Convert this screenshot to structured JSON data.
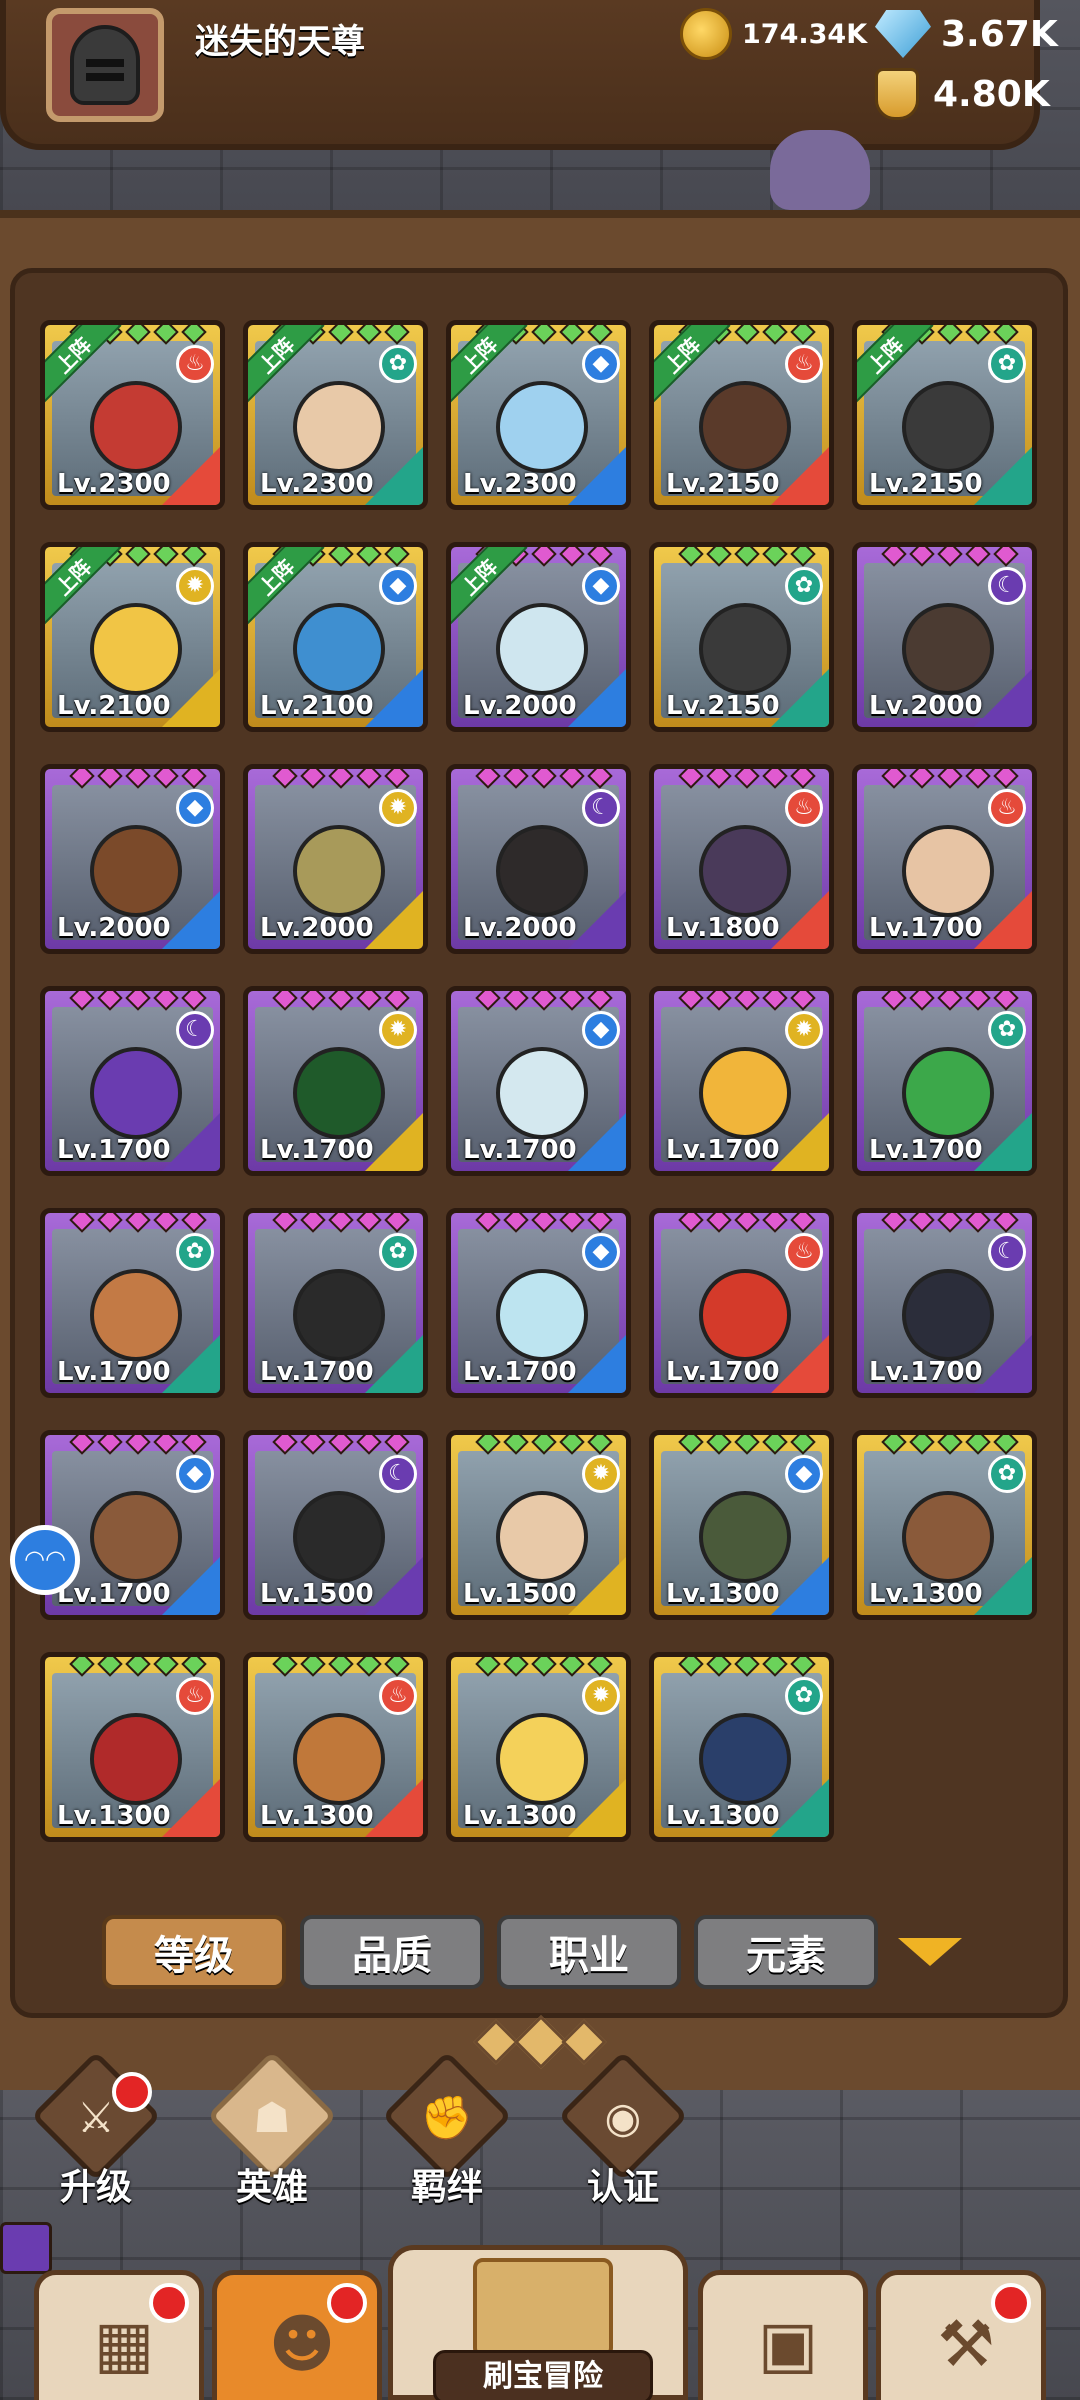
{
  "header": {
    "player_name": "迷失的天尊",
    "gold": "174.34K",
    "gems": "3.67K",
    "potions": "4.80K"
  },
  "on_team_label": "上阵",
  "heroes": [
    {
      "lv": "Lv.2300",
      "elem": "fire",
      "rarity": "gold",
      "on_team": true,
      "face": "#c43b33"
    },
    {
      "lv": "Lv.2300",
      "elem": "wind",
      "rarity": "gold",
      "on_team": true,
      "face": "#e8c9a8"
    },
    {
      "lv": "Lv.2300",
      "elem": "water",
      "rarity": "gold",
      "on_team": true,
      "face": "#9fd1ef"
    },
    {
      "lv": "Lv.2150",
      "elem": "fire",
      "rarity": "gold",
      "on_team": true,
      "face": "#5a3a2a"
    },
    {
      "lv": "Lv.2150",
      "elem": "wind",
      "rarity": "gold",
      "on_team": true,
      "face": "#3a3a3a"
    },
    {
      "lv": "Lv.2100",
      "elem": "light",
      "rarity": "gold",
      "on_team": true,
      "face": "#f1c545"
    },
    {
      "lv": "Lv.2100",
      "elem": "water",
      "rarity": "gold",
      "on_team": true,
      "face": "#3f8fd0"
    },
    {
      "lv": "Lv.2000",
      "elem": "water",
      "rarity": "purple",
      "on_team": true,
      "face": "#cfe6ef"
    },
    {
      "lv": "Lv.2150",
      "elem": "wind",
      "rarity": "gold",
      "on_team": false,
      "face": "#3a3a3a"
    },
    {
      "lv": "Lv.2000",
      "elem": "dark",
      "rarity": "purple",
      "on_team": false,
      "face": "#4b3b32"
    },
    {
      "lv": "Lv.2000",
      "elem": "water",
      "rarity": "purple",
      "on_team": false,
      "face": "#7b4a2a"
    },
    {
      "lv": "Lv.2000",
      "elem": "light",
      "rarity": "purple",
      "on_team": false,
      "face": "#a89a5a"
    },
    {
      "lv": "Lv.2000",
      "elem": "dark",
      "rarity": "purple",
      "on_team": false,
      "face": "#2e2a2a"
    },
    {
      "lv": "Lv.1800",
      "elem": "fire",
      "rarity": "purple",
      "on_team": false,
      "face": "#4a3a5a"
    },
    {
      "lv": "Lv.1700",
      "elem": "fire",
      "rarity": "purple",
      "on_team": false,
      "face": "#e7c4a4"
    },
    {
      "lv": "Lv.1700",
      "elem": "dark",
      "rarity": "purple",
      "on_team": false,
      "face": "#6a3cb0"
    },
    {
      "lv": "Lv.1700",
      "elem": "light",
      "rarity": "purple",
      "on_team": false,
      "face": "#1f5a2a"
    },
    {
      "lv": "Lv.1700",
      "elem": "water",
      "rarity": "purple",
      "on_team": false,
      "face": "#d4e8ef"
    },
    {
      "lv": "Lv.1700",
      "elem": "light",
      "rarity": "purple",
      "on_team": false,
      "face": "#f1b53a"
    },
    {
      "lv": "Lv.1700",
      "elem": "wind",
      "rarity": "purple",
      "on_team": false,
      "face": "#3ca84a"
    },
    {
      "lv": "Lv.1700",
      "elem": "wind",
      "rarity": "purple",
      "on_team": false,
      "face": "#c37a45"
    },
    {
      "lv": "Lv.1700",
      "elem": "wind",
      "rarity": "purple",
      "on_team": false,
      "face": "#2a2a2a"
    },
    {
      "lv": "Lv.1700",
      "elem": "water",
      "rarity": "purple",
      "on_team": false,
      "face": "#bde4f0"
    },
    {
      "lv": "Lv.1700",
      "elem": "fire",
      "rarity": "purple",
      "on_team": false,
      "face": "#d43a2a"
    },
    {
      "lv": "Lv.1700",
      "elem": "dark",
      "rarity": "purple",
      "on_team": false,
      "face": "#2b2d3a"
    },
    {
      "lv": "Lv.1700",
      "elem": "water",
      "rarity": "purple",
      "on_team": false,
      "face": "#8a5a3a"
    },
    {
      "lv": "Lv.1500",
      "elem": "dark",
      "rarity": "purple",
      "on_team": false,
      "face": "#2a2a2a"
    },
    {
      "lv": "Lv.1500",
      "elem": "light",
      "rarity": "gold",
      "on_team": false,
      "face": "#e8c9a8"
    },
    {
      "lv": "Lv.1300",
      "elem": "water",
      "rarity": "gold",
      "on_team": false,
      "face": "#4a5a3a"
    },
    {
      "lv": "Lv.1300",
      "elem": "wind",
      "rarity": "gold",
      "on_team": false,
      "face": "#8a5a3a"
    },
    {
      "lv": "Lv.1300",
      "elem": "fire",
      "rarity": "gold",
      "on_team": false,
      "face": "#b02a2a"
    },
    {
      "lv": "Lv.1300",
      "elem": "fire",
      "rarity": "gold",
      "on_team": false,
      "face": "#c0783a"
    },
    {
      "lv": "Lv.1300",
      "elem": "light",
      "rarity": "gold",
      "on_team": false,
      "face": "#f4d15a"
    },
    {
      "lv": "Lv.1300",
      "elem": "wind",
      "rarity": "gold",
      "on_team": false,
      "face": "#2a3f6a"
    }
  ],
  "sort_tabs": [
    "等级",
    "品质",
    "职业",
    "元素"
  ],
  "sub_nav": [
    "升级",
    "英雄",
    "羁绊",
    "认证"
  ],
  "bottom_nav": {
    "center_label": "刷宝冒险"
  }
}
